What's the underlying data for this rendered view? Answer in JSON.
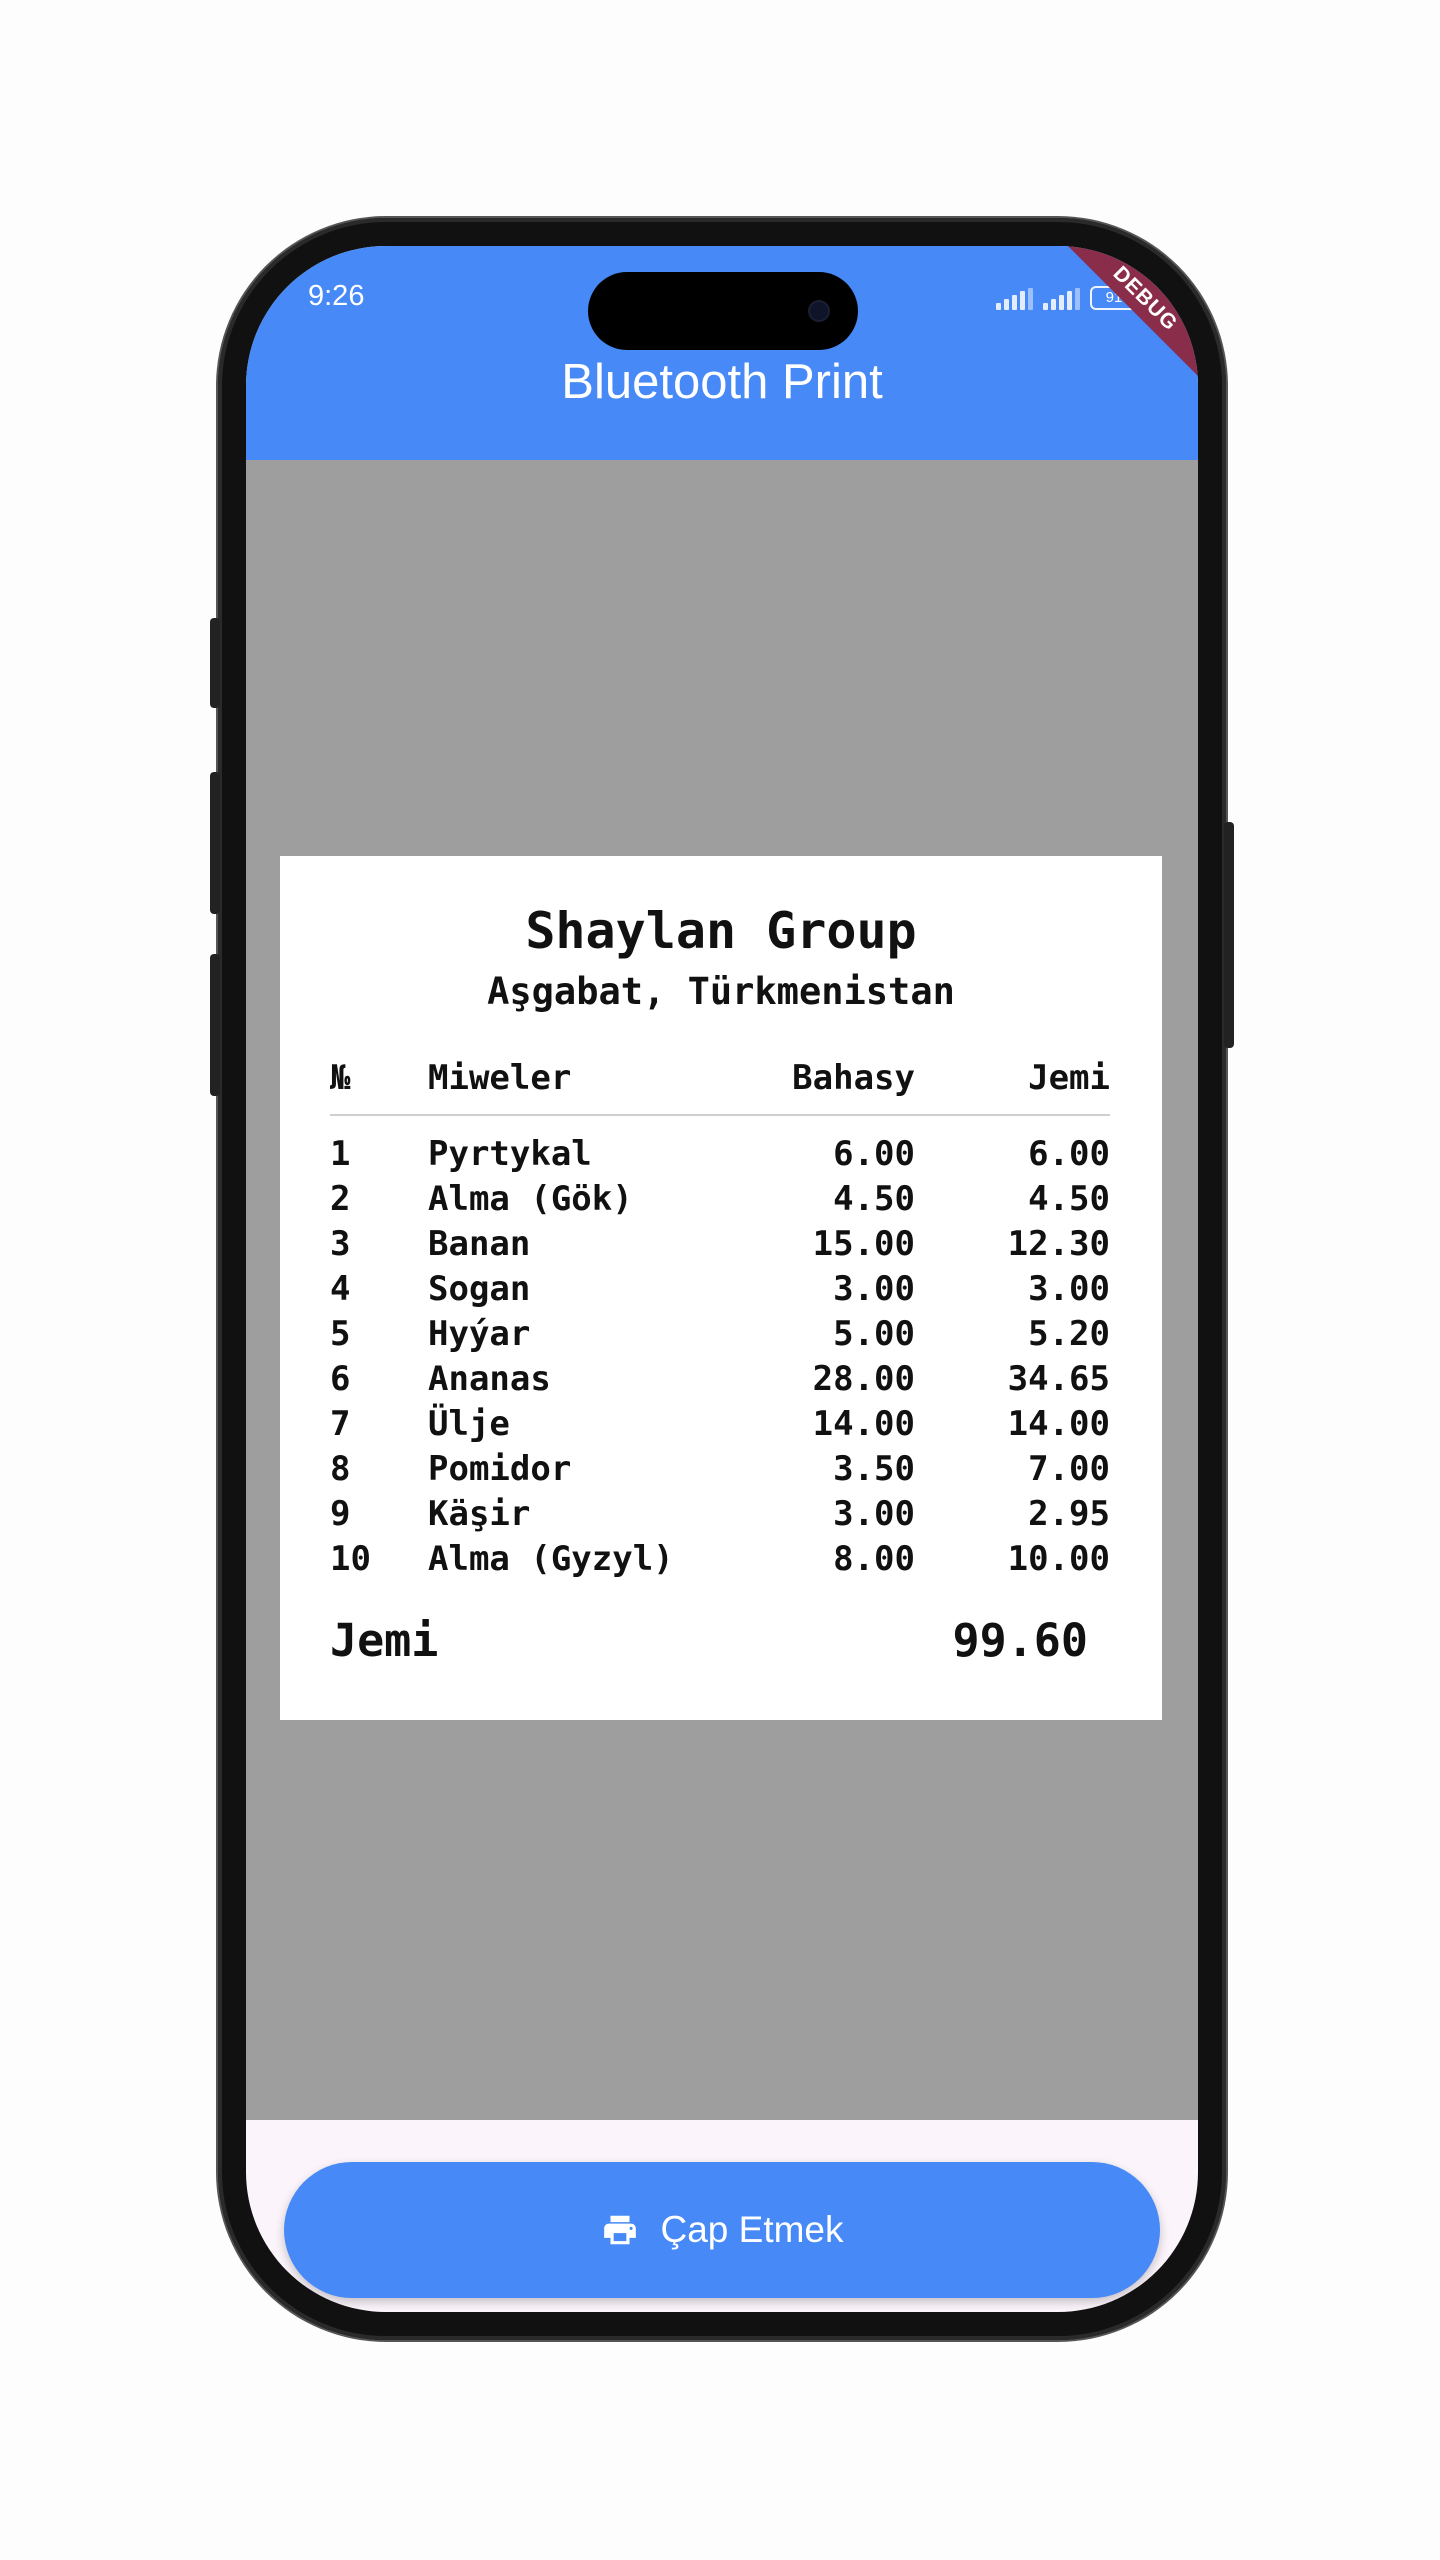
{
  "status_bar": {
    "time": "9:26",
    "battery": "91"
  },
  "debug_banner": "DEBUG",
  "app_bar": {
    "title": "Bluetooth Print"
  },
  "receipt": {
    "company": "Shaylan Group",
    "location": "Aşgabat, Türkmenistan",
    "columns": {
      "no": "№",
      "item": "Miweler",
      "price": "Bahasy",
      "total": "Jemi"
    },
    "rows": [
      {
        "no": "1",
        "item": "Pyrtykal",
        "price": "6.00",
        "total": "6.00"
      },
      {
        "no": "2",
        "item": "Alma (Gök)",
        "price": "4.50",
        "total": "4.50"
      },
      {
        "no": "3",
        "item": "Banan",
        "price": "15.00",
        "total": "12.30"
      },
      {
        "no": "4",
        "item": "Sogan",
        "price": "3.00",
        "total": "3.00"
      },
      {
        "no": "5",
        "item": "Hyýar",
        "price": "5.00",
        "total": "5.20"
      },
      {
        "no": "6",
        "item": "Ananas",
        "price": "28.00",
        "total": "34.65"
      },
      {
        "no": "7",
        "item": "Ülje",
        "price": "14.00",
        "total": "14.00"
      },
      {
        "no": "8",
        "item": "Pomidor",
        "price": "3.50",
        "total": "7.00"
      },
      {
        "no": "9",
        "item": "Käşir",
        "price": "3.00",
        "total": "2.95"
      },
      {
        "no": "10",
        "item": "Alma (Gyzyl)",
        "price": "8.00",
        "total": "10.00"
      }
    ],
    "sum_label": "Jemi",
    "sum_value": "99.60"
  },
  "print_button": {
    "label": "Çap Etmek",
    "icon": "printer-icon"
  },
  "colors": {
    "primary": "#4689f7",
    "preview_background": "#9e9e9e",
    "debug_ribbon": "#8a2d4a"
  }
}
